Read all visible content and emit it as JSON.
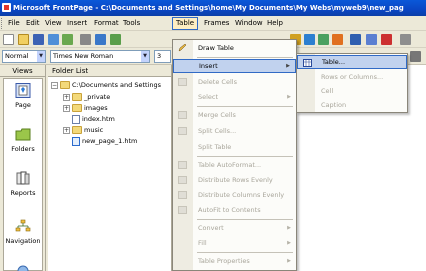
{
  "window": {
    "title": "Microsoft FrontPage - C:\\Documents and Settings\\home\\My Documents\\My Webs\\myweb9\\new_pag"
  },
  "menubar": {
    "items": [
      {
        "label": "File"
      },
      {
        "label": "Edit"
      },
      {
        "label": "View"
      },
      {
        "label": "Insert"
      },
      {
        "label": "Format"
      },
      {
        "label": "Tools"
      },
      {
        "label": "Table",
        "active": true
      },
      {
        "label": "Frames"
      },
      {
        "label": "Window"
      },
      {
        "label": "Help"
      }
    ]
  },
  "formatting": {
    "style": "Normal",
    "font": "Times New Roman",
    "size": "3"
  },
  "views": {
    "header": "Views",
    "items": [
      {
        "label": "Page",
        "icon": "page-view-icon"
      },
      {
        "label": "Folders",
        "icon": "folders-view-icon"
      },
      {
        "label": "Reports",
        "icon": "reports-view-icon"
      },
      {
        "label": "Navigation",
        "icon": "navigation-view-icon"
      }
    ]
  },
  "folder_list": {
    "header": "Folder List",
    "root": "C:\\Documents and Settings",
    "items": [
      {
        "label": "_private",
        "type": "folder",
        "expandable": true
      },
      {
        "label": "images",
        "type": "folder",
        "expandable": true
      },
      {
        "label": "index.htm",
        "type": "file"
      },
      {
        "label": "music",
        "type": "folder",
        "expandable": true
      },
      {
        "label": "new_page_1.htm",
        "type": "file"
      }
    ]
  },
  "table_menu": {
    "items": [
      {
        "label": "Draw Table",
        "enabled": true,
        "icon": "pencil-icon"
      },
      {
        "label": "Insert",
        "enabled": true,
        "submenu": true,
        "highlight": true
      },
      {
        "label": "Delete Cells",
        "enabled": false
      },
      {
        "label": "Select",
        "enabled": false,
        "submenu": true
      },
      {
        "label": "Merge Cells",
        "enabled": false
      },
      {
        "label": "Split Cells...",
        "enabled": false
      },
      {
        "label": "Split Table",
        "enabled": false
      },
      {
        "label": "Table AutoFormat...",
        "enabled": false
      },
      {
        "label": "Distribute Rows Evenly",
        "enabled": false
      },
      {
        "label": "Distribute Columns Evenly",
        "enabled": false
      },
      {
        "label": "AutoFit to Contents",
        "enabled": false
      },
      {
        "label": "Convert",
        "enabled": false,
        "submenu": true
      },
      {
        "label": "Fill",
        "enabled": false,
        "submenu": true
      },
      {
        "label": "Table Properties",
        "enabled": false,
        "submenu": true
      }
    ]
  },
  "insert_submenu": {
    "items": [
      {
        "label": "Table...",
        "enabled": true,
        "highlight": true
      },
      {
        "label": "Rows or Columns...",
        "enabled": false
      },
      {
        "label": "Cell",
        "enabled": false
      },
      {
        "label": "Caption",
        "enabled": false
      }
    ]
  },
  "colors": {
    "titlebar": "#0a46c4",
    "highlight": "#c1d2ee",
    "accent": "#316ac5"
  }
}
